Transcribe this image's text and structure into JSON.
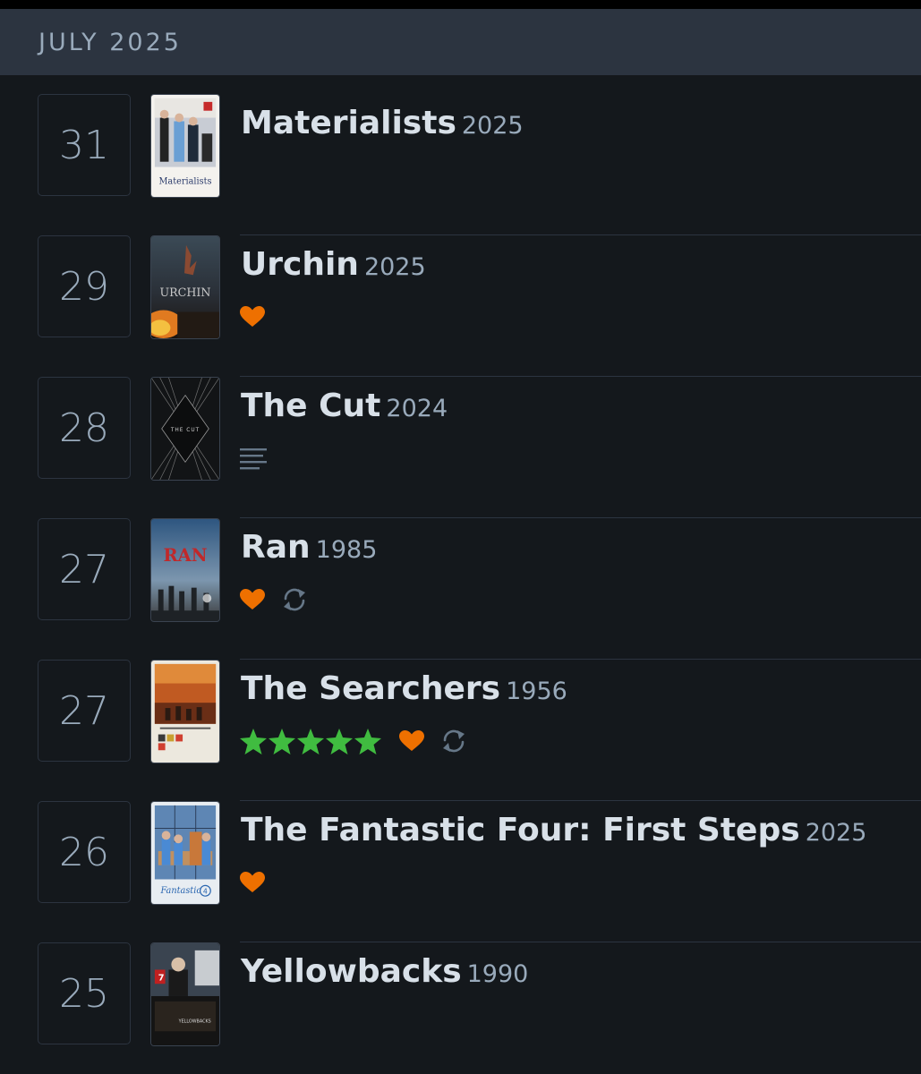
{
  "header": {
    "month": "JULY 2025"
  },
  "colors": {
    "heart": "#ee7000",
    "star": "#40bc40",
    "muted_icon": "#678"
  },
  "entries": [
    {
      "day": "31",
      "title": "Materialists",
      "year": "2025",
      "liked": false,
      "rewatch": false,
      "review": false,
      "stars": 0
    },
    {
      "day": "29",
      "title": "Urchin",
      "year": "2025",
      "liked": true,
      "rewatch": false,
      "review": false,
      "stars": 0
    },
    {
      "day": "28",
      "title": "The Cut",
      "year": "2024",
      "liked": false,
      "rewatch": false,
      "review": true,
      "stars": 0
    },
    {
      "day": "27",
      "title": "Ran",
      "year": "1985",
      "liked": true,
      "rewatch": true,
      "review": false,
      "stars": 0
    },
    {
      "day": "27",
      "title": "The Searchers",
      "year": "1956",
      "liked": true,
      "rewatch": true,
      "review": false,
      "stars": 5
    },
    {
      "day": "26",
      "title": "The Fantastic Four: First Steps",
      "year": "2025",
      "liked": true,
      "rewatch": false,
      "review": false,
      "stars": 0
    },
    {
      "day": "25",
      "title": "Yellowbacks",
      "year": "1990",
      "liked": false,
      "rewatch": false,
      "review": false,
      "stars": 0
    }
  ],
  "posters": {
    "0": {
      "caption": "Materialists"
    },
    "1": {
      "caption": "URCHIN"
    },
    "2": {
      "caption": "THE CUT"
    },
    "3": {
      "caption": "RAN"
    },
    "6": {
      "caption": "YELLOWBACKS"
    }
  }
}
